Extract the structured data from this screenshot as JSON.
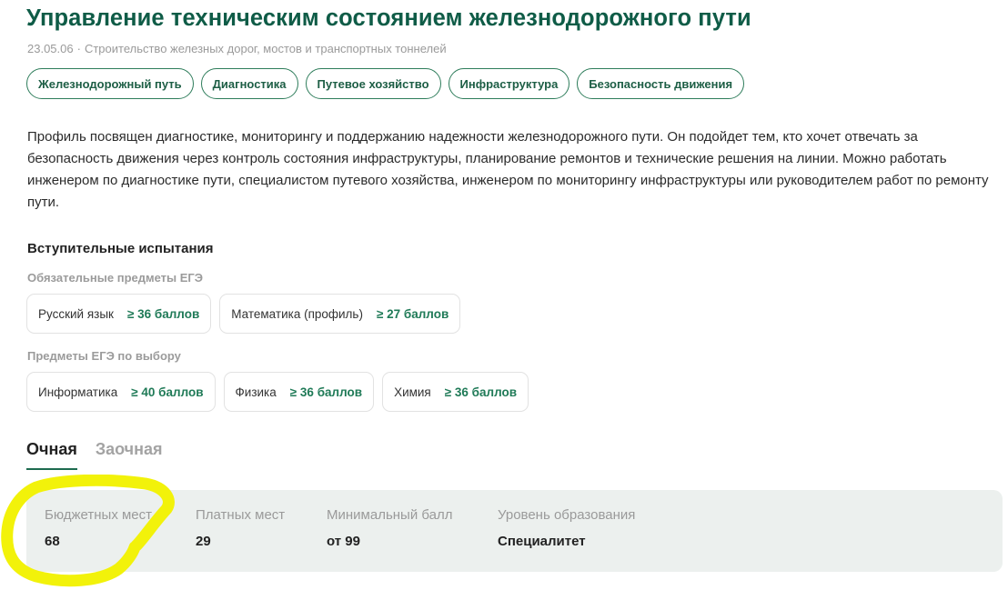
{
  "program": {
    "title": "Управление техническим состоянием железнодорожного пути",
    "code": "23.05.06",
    "separator": "·",
    "direction": "Строительство железных дорог, мостов и транспортных тоннелей"
  },
  "tags": [
    "Железнодорожный путь",
    "Диагностика",
    "Путевое хозяйство",
    "Инфраструктура",
    "Безопасность движения"
  ],
  "description": "Профиль посвящен диагностике, мониторингу и поддержанию надежности железнодорожного пути. Он подойдет тем, кто хочет отвечать за безопасность движения через контроль состояния инфраструктуры, планирование ремонтов и технические решения на линии. Можно работать инженером по диагностике пути, специалистом путевого хозяйства, инженером по мониторингу инфраструктуры или руководителем работ по ремонту пути.",
  "exams": {
    "title": "Вступительные испытания",
    "required_title": "Обязательные предметы ЕГЭ",
    "required": [
      {
        "name": "Русский язык",
        "score": "≥ 36 баллов"
      },
      {
        "name": "Математика (профиль)",
        "score": "≥ 27 баллов"
      }
    ],
    "optional_title": "Предметы ЕГЭ по выбору",
    "optional": [
      {
        "name": "Информатика",
        "score": "≥ 40 баллов"
      },
      {
        "name": "Физика",
        "score": "≥ 36 баллов"
      },
      {
        "name": "Химия",
        "score": "≥ 36 баллов"
      }
    ]
  },
  "tabs": [
    {
      "label": "Очная",
      "active": true
    },
    {
      "label": "Заочная",
      "active": false
    }
  ],
  "stats": [
    {
      "label": "Бюджетных мест",
      "value": "68"
    },
    {
      "label": "Платных мест",
      "value": "29"
    },
    {
      "label": "Минимальный балл",
      "value": "от 99"
    },
    {
      "label": "Уровень образования",
      "value": "Специалитет"
    }
  ],
  "colors": {
    "brand_green": "#0f5c47",
    "score_green": "#1f7a57",
    "stats_bg": "#ecf0ee",
    "annotation_yellow": "#f2f20a"
  }
}
